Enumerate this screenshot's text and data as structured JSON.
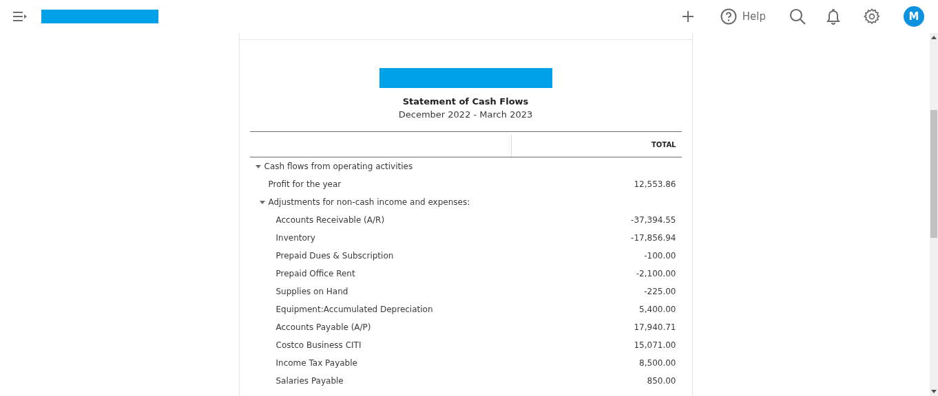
{
  "header": {
    "help_label": "Help",
    "avatar_initial": "M"
  },
  "report": {
    "title": "Statement of Cash Flows",
    "period": "December 2022 - March 2023",
    "column_header": "TOTAL",
    "rows": [
      {
        "label": "Cash flows from operating activities",
        "expanded": true,
        "children": [
          {
            "label": "Profit for the year",
            "value": "12,553.86"
          },
          {
            "label": "Adjustments for non-cash income and expenses:",
            "expanded": true,
            "children": [
              {
                "label": "Accounts Receivable (A/R)",
                "value": "-37,394.55"
              },
              {
                "label": "Inventory",
                "value": "-17,856.94"
              },
              {
                "label": "Prepaid Dues & Subscription",
                "value": "-100.00"
              },
              {
                "label": "Prepaid Office Rent",
                "value": "-2,100.00"
              },
              {
                "label": "Supplies on Hand",
                "value": "-225.00"
              },
              {
                "label": "Equipment:Accumulated Depreciation",
                "value": "5,400.00"
              },
              {
                "label": "Accounts Payable (A/P)",
                "value": "17,940.71"
              },
              {
                "label": "Costco Business CITI",
                "value": "15,071.00"
              },
              {
                "label": "Income Tax Payable",
                "value": "8,500.00"
              },
              {
                "label": "Salaries Payable",
                "value": "850.00"
              }
            ]
          }
        ]
      }
    ]
  }
}
